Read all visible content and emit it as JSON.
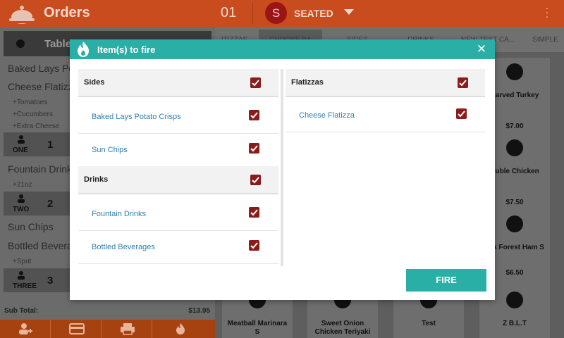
{
  "app": {
    "title": "Orders",
    "table_number": "01",
    "server_initial": "S",
    "status": "SEATED"
  },
  "left_panel": {
    "table_label": "Table",
    "items": [
      {
        "label": "Baked Lays Po"
      },
      {
        "label": "Cheese Flatizz"
      },
      {
        "label": "Fountain Drink"
      },
      {
        "label": "Sun Chips"
      },
      {
        "label": "Bottled Bevera"
      }
    ],
    "modifiers": [
      "+Tomatoes",
      "+Cucumbers",
      "+Extra Cheese",
      "+21oz",
      "+Sprit"
    ],
    "seats": [
      {
        "name": "ONE",
        "count": "1"
      },
      {
        "name": "TWO",
        "count": "2"
      },
      {
        "name": "THREE",
        "count": "3"
      }
    ],
    "subtotal_label": "Sub Total:",
    "subtotal_value": "$13.95"
  },
  "category_tabs": [
    "ITIZZAS",
    "CHOOSE BA",
    "SIDES",
    "DRINKS",
    "NEW TEST CA...",
    "SIMPLE"
  ],
  "menu_tiles": [
    {
      "name": "Carved Turkey",
      "price": "$7.00"
    },
    {
      "name": "Duble Chicken",
      "price": "$7.50"
    },
    {
      "name": "ack Forest Ham S",
      "price": "$6.50"
    },
    {
      "name": "Meatball Marinara S",
      "price": ""
    },
    {
      "name": "Sweet Onion Chicken Teriyaki",
      "price": ""
    },
    {
      "name": "Test",
      "price": ""
    },
    {
      "name": "Z B.L.T",
      "price": ""
    }
  ],
  "modal": {
    "title": "Item(s) to fire",
    "fire_label": "FIRE",
    "groups": {
      "sides": {
        "label": "Sides",
        "checked": true,
        "items": [
          {
            "label": "Baked Lays Potato Crisps",
            "checked": true
          },
          {
            "label": "Sun Chips",
            "checked": true
          }
        ]
      },
      "drinks": {
        "label": "Drinks",
        "checked": true,
        "items": [
          {
            "label": "Fountain Drinks",
            "checked": true
          },
          {
            "label": "Bottled Beverages",
            "checked": true
          }
        ]
      },
      "flatizzas": {
        "label": "Flatizzas",
        "checked": true,
        "items": [
          {
            "label": "Cheese Flatizza",
            "checked": true
          }
        ]
      }
    }
  },
  "colors": {
    "brand_orange": "#c84c1e",
    "teal": "#2aafa7",
    "checkbox": "#8c1b1b",
    "item_link": "#2e7fb0"
  }
}
